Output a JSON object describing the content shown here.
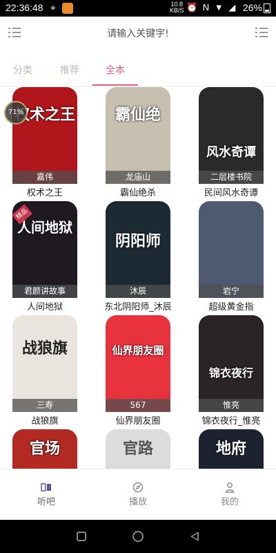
{
  "status_bar": {
    "time": "22:36:48",
    "net_speed_value": "10.8",
    "net_speed_unit": "KB/S",
    "battery": "26%"
  },
  "search": {
    "placeholder": "请输入关键字!"
  },
  "tabs": [
    {
      "label": "分类",
      "active": false
    },
    {
      "label": "推荐",
      "active": false
    },
    {
      "label": "全本",
      "active": true
    }
  ],
  "books": [
    {
      "title": "权术之王",
      "author": "嘉伟",
      "cover_text": "权术之王",
      "cover_color": "#b1161c",
      "progress": "71%"
    },
    {
      "title": "霸仙绝杀",
      "author": "龙庙山",
      "cover_text": "霸仙绝",
      "cover_color": "#c7c0b0"
    },
    {
      "title": "民间风水奇谭",
      "author": "二层楼书院",
      "cover_text": "风水奇谭",
      "cover_color": "#2a2a2a"
    },
    {
      "title": "人间地狱",
      "author": "君颜讲故事",
      "cover_text": "人间地狱",
      "cover_color": "#1f1a22",
      "badge": "精品"
    },
    {
      "title": "东北阴阳师_沐辰",
      "author": "沐辰",
      "cover_text": "阴阳师",
      "cover_color": "#1c2a33"
    },
    {
      "title": "超级黄金指",
      "author": "岩宁",
      "cover_text": "",
      "cover_color": "#4d5a70"
    },
    {
      "title": "战狼旗",
      "author": "三寿",
      "cover_text": "战狼旗",
      "cover_color": "#e9e4dd"
    },
    {
      "title": "仙界朋友圈",
      "author": "567",
      "cover_text": "仙界朋友圈",
      "cover_color": "#e8333f"
    },
    {
      "title": "锦衣夜行_惟亮",
      "author": "惟亮",
      "cover_text": "锦衣夜行",
      "cover_color": "#2b2426"
    },
    {
      "title": "",
      "author": "",
      "cover_text": "官场",
      "cover_color": "#b32a23"
    },
    {
      "title": "",
      "author": "",
      "cover_text": "官路",
      "cover_color": "#dcdcdc"
    },
    {
      "title": "",
      "author": "",
      "cover_text": "地府",
      "cover_color": "#1d2230"
    }
  ],
  "bottom_nav": [
    {
      "label": "听吧",
      "icon": "book-icon",
      "active": true
    },
    {
      "label": "播放",
      "icon": "compass-icon",
      "active": false
    },
    {
      "label": "我的",
      "icon": "user-icon",
      "active": false
    }
  ]
}
